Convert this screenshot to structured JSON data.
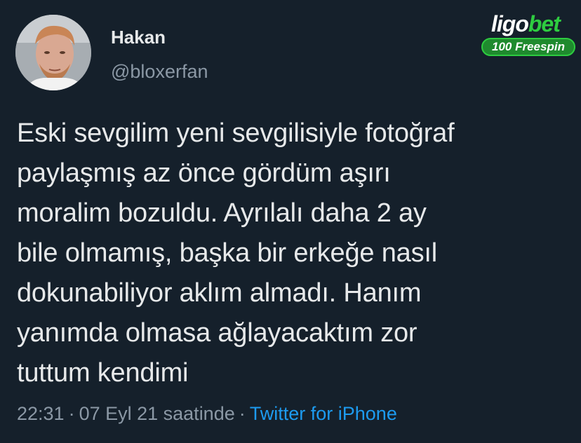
{
  "author": {
    "display_name": "Hakan",
    "handle": "@bloxerfan",
    "avatar_icon": "profile-photo"
  },
  "tweet": {
    "text": "Eski sevgilim yeni sevgilisiyle fotoğraf\npaylaşmış az önce gördüm aşırı\nmoralim bozuldu. Ayrılalı daha 2 ay\nbile olmamış, başka bir erkeğe nasıl\ndokunabiliyor aklım almadı. Hanım\nyanımda olmasa ağlayacaktım zor\ntuttum kendimi",
    "time": "22:31",
    "date": "07 Eyl 21 saatinde",
    "separator": "·",
    "source": "Twitter for iPhone"
  },
  "brand": {
    "logo_part1": "ligo",
    "logo_part2": "bet",
    "badge": "100 Freespin"
  },
  "colors": {
    "background": "#15202b",
    "text": "#e7e9ea",
    "secondary": "#8b98a5",
    "link": "#1d9bf0",
    "brand_green": "#2ecc40"
  }
}
